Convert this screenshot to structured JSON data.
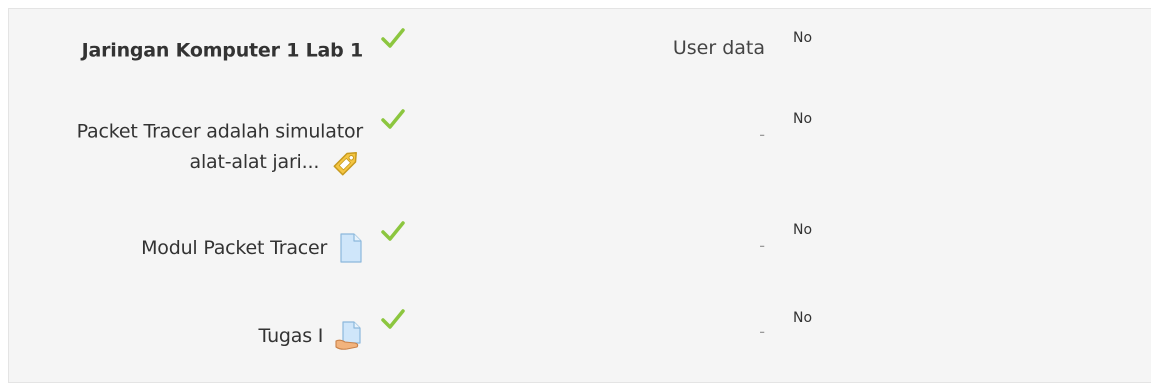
{
  "rows": [
    {
      "label": "Jaringan Komputer 1 Lab 1",
      "label_line2": "",
      "icon": "",
      "middle": "User data",
      "value": "No"
    },
    {
      "label": "Packet Tracer adalah simulator",
      "label_line2": "alat-alat jari...",
      "icon": "url-tag-icon",
      "middle": "-",
      "value": "No"
    },
    {
      "label": "Modul Packet Tracer",
      "label_line2": "",
      "icon": "document-file-icon",
      "middle": "-",
      "value": "No"
    },
    {
      "label": "Tugas I",
      "label_line2": "",
      "icon": "assignment-icon",
      "middle": "-",
      "value": "No"
    }
  ],
  "colors": {
    "check": "#8cc63f",
    "panel_bg": "#f5f5f5",
    "tag": "#f4c542",
    "doc": "#cfe6fa"
  }
}
